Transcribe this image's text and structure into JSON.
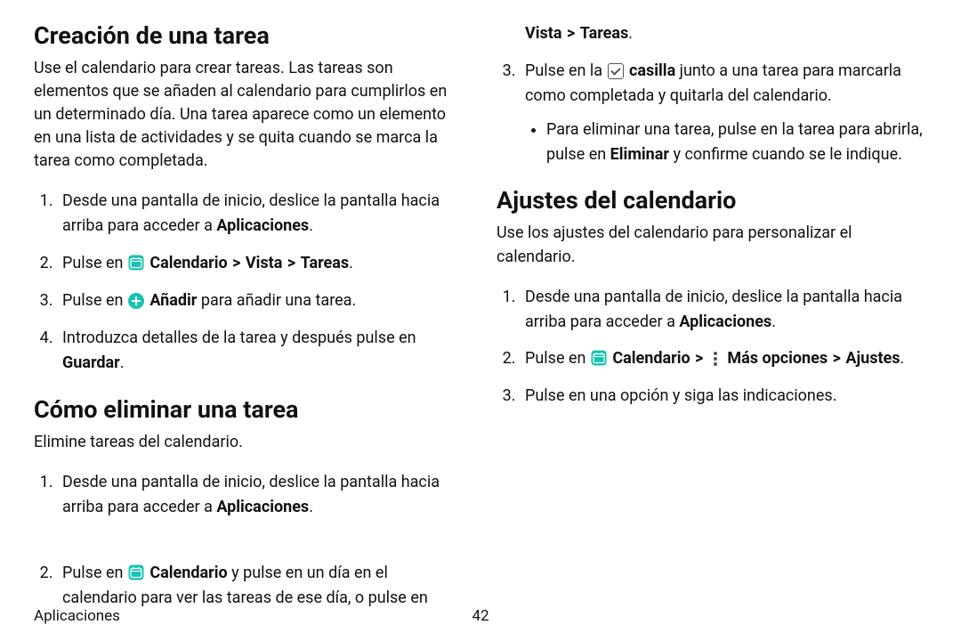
{
  "sections": {
    "create": {
      "heading": "Creación de una tarea",
      "lead": "Use el calendario para crear tareas. Las tareas son elementos que se añaden al calendario para cumplirlos en un determinado día. Una tarea aparece como un elemento en una lista de actividades y se quita cuando se marca la tarea como completada.",
      "steps": {
        "s1_a": "Desde una pantalla de inicio, deslice la pantalla hacia arriba para acceder a ",
        "s1_b": "Aplicaciones",
        "s1_c": ".",
        "s2_a": "Pulse en ",
        "s2_b": "Calendario",
        "s2_c": "Vista",
        "s2_d": "Tareas",
        "s2_e": ".",
        "s3_a": "Pulse en ",
        "s3_b": "Añadir",
        "s3_c": " para añadir una tarea.",
        "s4_a": "Introduzca detalles de la tarea y después pulse en ",
        "s4_b": "Guardar",
        "s4_c": "."
      }
    },
    "delete": {
      "heading": "Cómo eliminar una tarea",
      "lead": "Elimine tareas del calendario.",
      "steps": {
        "s1_a": "Desde una pantalla de inicio, deslice la pantalla hacia arriba para acceder a ",
        "s1_b": "Aplicaciones",
        "s1_c": ".",
        "s2_a": "Pulse en ",
        "s2_b": "Calendario",
        "s2_c": " y pulse en un día en el calendario para ver las tareas de ese día, o pulse en ",
        "s2_d": "Vista",
        "s2_e": "Tareas",
        "s2_f": ".",
        "s3_a": "Pulse en la ",
        "s3_b": "casilla",
        "s3_c": " junto a una tarea para marcarla como completada y quitarla del calendario.",
        "bul_a": "Para eliminar una tarea, pulse en la tarea para abrirla, pulse en ",
        "bul_b": "Eliminar",
        "bul_c": " y confirme cuando se le indique."
      }
    },
    "settings": {
      "heading": "Ajustes del calendario",
      "lead": "Use los ajustes del calendario para personalizar el calendario.",
      "steps": {
        "s1_a": "Desde una pantalla de inicio, deslice la pantalla hacia arriba para acceder a ",
        "s1_b": "Aplicaciones",
        "s1_c": ".",
        "s2_a": "Pulse en ",
        "s2_b": "Calendario",
        "s2_c": "Más opciones",
        "s2_d": "Ajustes",
        "s2_e": ".",
        "s3": "Pulse en una opción y siga las indicaciones."
      }
    }
  },
  "nav": {
    "chevron": ">"
  },
  "footer": {
    "section": "Aplicaciones",
    "page": "42"
  }
}
